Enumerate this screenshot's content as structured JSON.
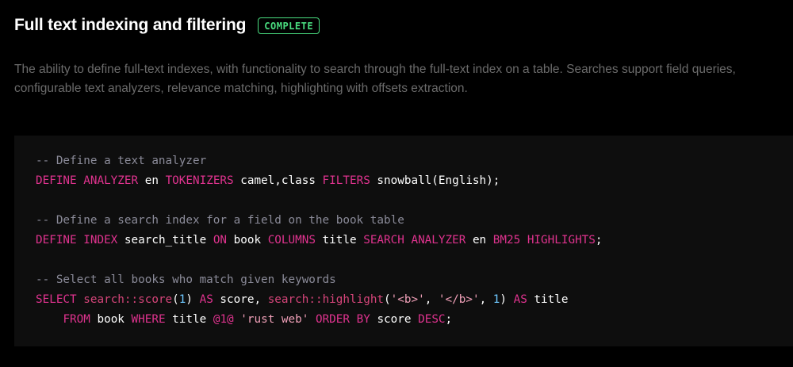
{
  "feature": {
    "title": "Full text indexing and filtering",
    "status": "COMPLETE",
    "description": "The ability to define full-text indexes, with functionality to search through the full-text index on a table. Searches support field queries, configurable text analyzers, relevance matching, highlighting with offsets extraction."
  },
  "code": {
    "comment1": "-- Define a text analyzer",
    "line1": {
      "kw1": "DEFINE ANALYZER",
      "t1": " en ",
      "kw2": "TOKENIZERS",
      "t2": " camel,class ",
      "kw3": "FILTERS",
      "t3": " snowball(English);"
    },
    "comment2": "-- Define a search index for a field on the book table",
    "line2": {
      "kw1": "DEFINE INDEX",
      "t1": " search_title ",
      "kw2": "ON",
      "t2": " book ",
      "kw3": "COLUMNS",
      "t3": " title ",
      "kw4": "SEARCH ANALYZER",
      "t4": " en ",
      "kw5": "BM25 HIGHLIGHTS",
      "t5": ";"
    },
    "comment3": "-- Select all books who match given keywords",
    "line3": {
      "kw1": "SELECT",
      "t0": " ",
      "fn1": "search::score",
      "p1": "(",
      "n1": "1",
      "p2": ") ",
      "kw2": "AS",
      "t1": " score, ",
      "fn2": "search::highlight",
      "p3": "(",
      "s1": "'<b>'",
      "p4": ", ",
      "s2": "'</b>'",
      "p5": ", ",
      "n2": "1",
      "p6": ") ",
      "kw3": "AS",
      "t2": " title"
    },
    "line4": {
      "indent": "    ",
      "kw1": "FROM",
      "t1": " book ",
      "kw2": "WHERE",
      "t2": " title ",
      "op1": "@1@",
      "t3": " ",
      "s1": "'rust web'",
      "t4": " ",
      "kw3": "ORDER BY",
      "t5": " score ",
      "kw4": "DESC",
      "t6": ";"
    }
  },
  "colors": {
    "keyword": "#e0338f",
    "comment": "#8b8b99",
    "number": "#6ec8ff",
    "string": "#f0a0b8",
    "badge": "#4ade80",
    "description": "#6b6b6b"
  }
}
